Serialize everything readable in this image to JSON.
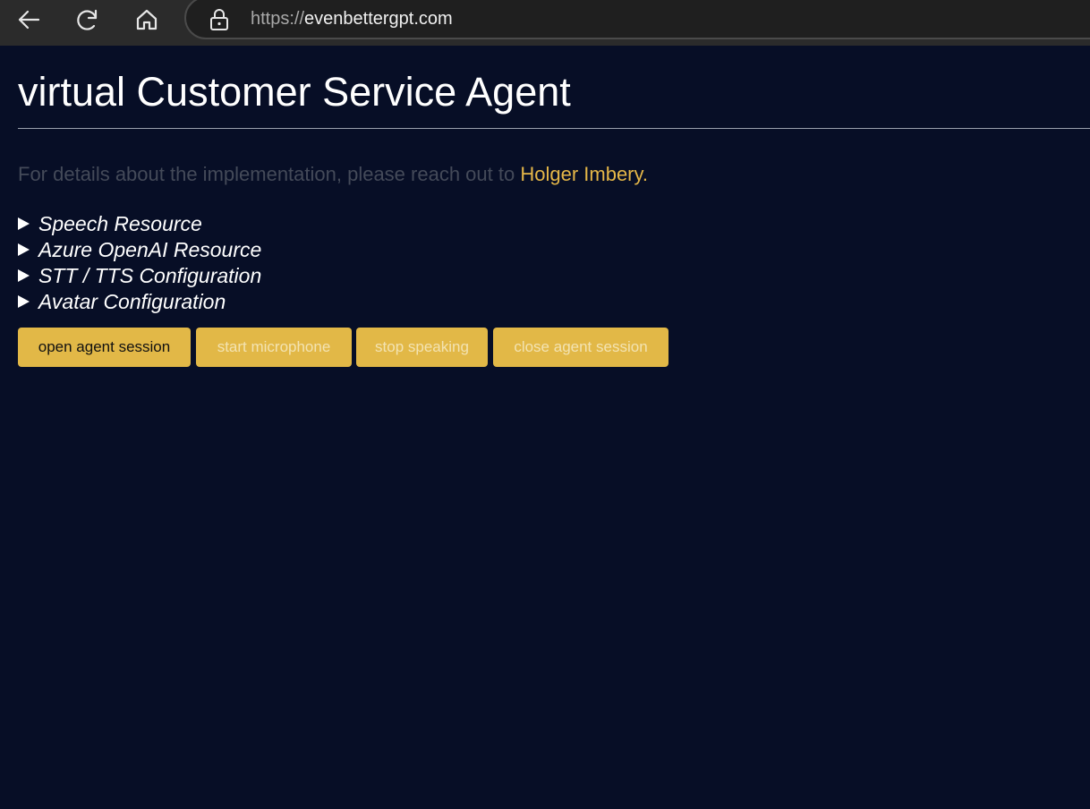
{
  "browser": {
    "url_scheme": "https://",
    "url_host": "evenbettergpt.com"
  },
  "page": {
    "title": "virtual Customer Service Agent",
    "intro_text": "For details about the implementation, please reach out to ",
    "contact_link": "Holger Imbery.",
    "sections": [
      {
        "label": "Speech Resource"
      },
      {
        "label": "Azure OpenAI Resource"
      },
      {
        "label": "STT / TTS Configuration"
      },
      {
        "label": "Avatar Configuration"
      }
    ],
    "buttons": [
      {
        "label": "open agent session",
        "enabled": true
      },
      {
        "label": "start microphone",
        "enabled": false
      },
      {
        "label": "stop speaking",
        "enabled": false
      },
      {
        "label": "close agent session",
        "enabled": false
      }
    ]
  },
  "colors": {
    "background": "#070e26",
    "accent": "#e2b847",
    "link": "#e5b748"
  }
}
